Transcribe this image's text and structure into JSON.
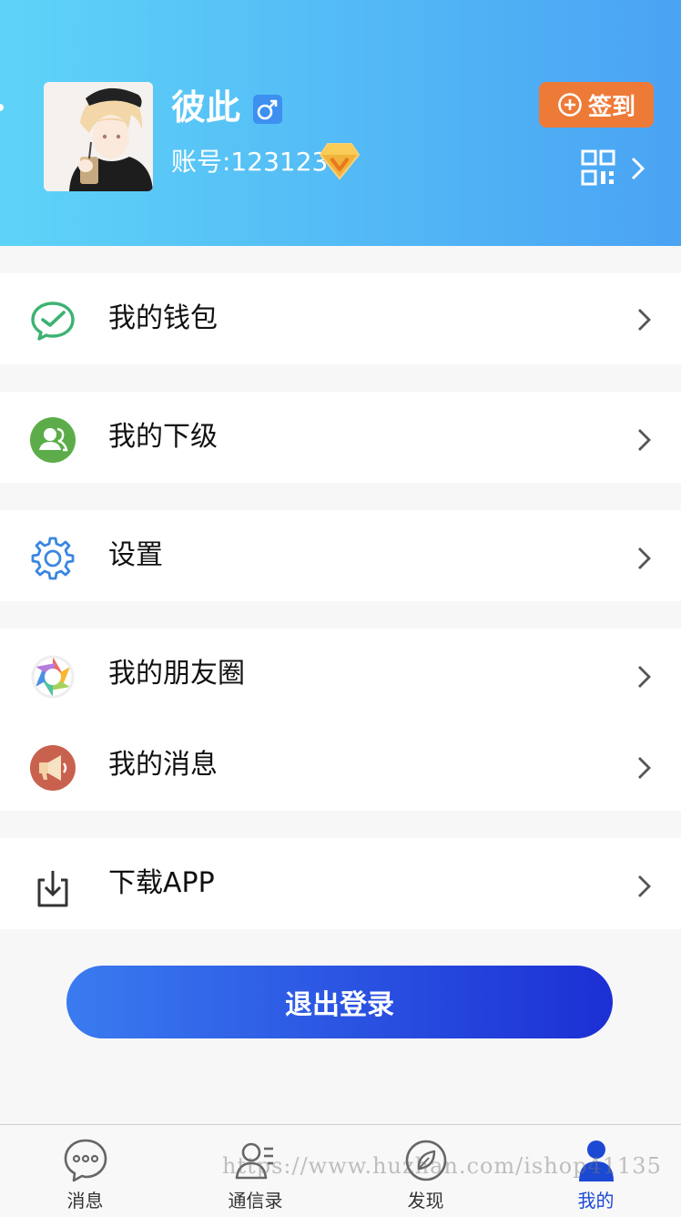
{
  "profile": {
    "username": "彼此",
    "gender_icon": "male-icon",
    "account": "账号:123123",
    "vip_icon": "vip-diamond-icon",
    "signin_label": "签到",
    "qr_icon": "qr-code-icon"
  },
  "menu": {
    "wallet": {
      "label": "我的钱包",
      "icon": "wechat-pay-icon"
    },
    "subordinates": {
      "label": "我的下级",
      "icon": "users-icon"
    },
    "settings": {
      "label": "设置",
      "icon": "gear-icon"
    },
    "moments": {
      "label": "我的朋友圈",
      "icon": "aperture-icon"
    },
    "messages": {
      "label": "我的消息",
      "icon": "megaphone-icon"
    },
    "download": {
      "label": "下载APP",
      "icon": "download-icon"
    }
  },
  "logout_label": "退出登录",
  "tabs": [
    {
      "label": "消息",
      "icon": "chat-bubble-icon"
    },
    {
      "label": "通信录",
      "icon": "contacts-icon"
    },
    {
      "label": "发现",
      "icon": "compass-leaf-icon"
    },
    {
      "label": "我的",
      "icon": "person-icon"
    }
  ],
  "watermark": "https://www.huzhan.com/ishop41135",
  "colors": {
    "header_start": "#5ed3f8",
    "header_end": "#4aa3f3",
    "signin_bg": "#ee7a37",
    "logout_start": "#3a7bf0",
    "logout_end": "#1c2fd4",
    "active_tab": "#1c49d4"
  }
}
